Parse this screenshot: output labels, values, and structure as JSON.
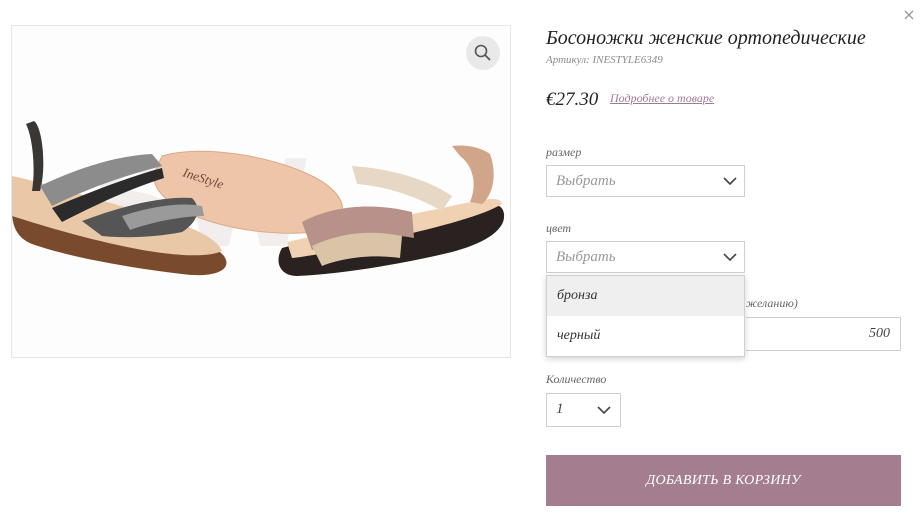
{
  "dialog": {
    "close_glyph": "×"
  },
  "product": {
    "title": "Босоножки женские ортопедические",
    "sku": "Артикул: INESTYLE6349",
    "price": "€27.30",
    "details_link": "Подробнее о товаре",
    "image_brand_text": "IneStyle",
    "accent_color": "#a47d8e"
  },
  "options": {
    "size": {
      "label": "размер",
      "value": "Выбрать"
    },
    "color": {
      "label": "цвет",
      "value": "Выбрать",
      "dropdown": [
        "бронза",
        "черный"
      ],
      "highlighted_index": 0
    },
    "partial_label": "желанию)",
    "input_value": "500",
    "quantity": {
      "label": "Количество",
      "value": "1"
    }
  },
  "cart": {
    "add_button": "ДОБАВИТЬ В КОРЗИНУ"
  },
  "icons": {
    "zoom": "search-icon",
    "close": "close-icon",
    "chevron": "chevron-down-icon"
  }
}
